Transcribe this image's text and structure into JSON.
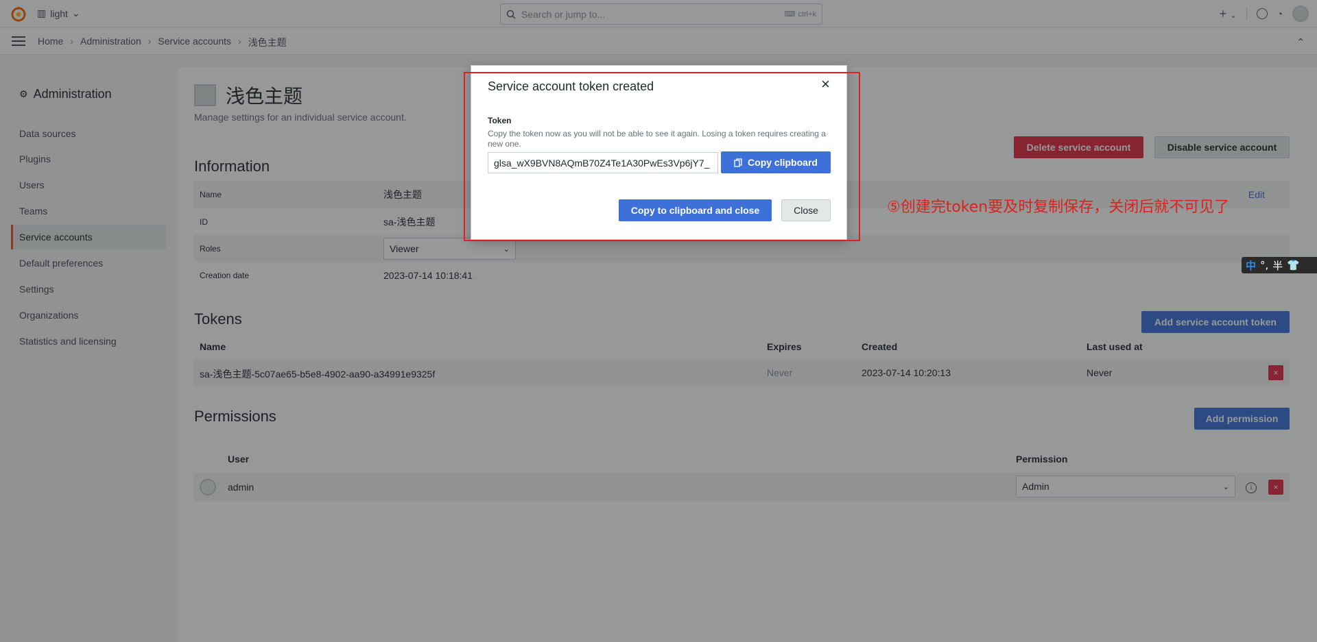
{
  "topbar": {
    "org_name": "light",
    "search_placeholder": "Search or jump to...",
    "search_shortcut": "ctrl+k",
    "plus_label": "+"
  },
  "breadcrumb": [
    "Home",
    "Administration",
    "Service accounts",
    "浅色主题"
  ],
  "sidebar": {
    "title": "Administration",
    "items": [
      {
        "label": "Data sources"
      },
      {
        "label": "Plugins"
      },
      {
        "label": "Users"
      },
      {
        "label": "Teams"
      },
      {
        "label": "Service accounts"
      },
      {
        "label": "Default preferences"
      },
      {
        "label": "Settings"
      },
      {
        "label": "Organizations"
      },
      {
        "label": "Statistics and licensing"
      }
    ]
  },
  "account": {
    "title": "浅色主题",
    "subtitle": "Manage settings for an individual service account.",
    "delete_label": "Delete service account",
    "disable_label": "Disable service account"
  },
  "information": {
    "heading": "Information",
    "rows": [
      {
        "label": "Name",
        "value": "浅色主题",
        "action": "Edit"
      },
      {
        "label": "ID",
        "value": "sa-浅色主题"
      },
      {
        "label": "Roles",
        "value": "Viewer"
      },
      {
        "label": "Creation date",
        "value": "2023-07-14 10:18:41"
      }
    ]
  },
  "tokens": {
    "heading": "Tokens",
    "add_label": "Add service account token",
    "columns": [
      "Name",
      "Expires",
      "Created",
      "Last used at"
    ],
    "rows": [
      {
        "name": "sa-浅色主题-5c07ae65-b5e8-4902-aa90-a34991e9325f",
        "expires": "Never",
        "created": "2023-07-14 10:20:13",
        "last_used": "Never",
        "delete": "×"
      }
    ]
  },
  "permissions": {
    "heading": "Permissions",
    "add_label": "Add permission",
    "columns": [
      "User",
      "Permission"
    ],
    "rows": [
      {
        "user": "admin",
        "permission": "Admin",
        "delete": "×"
      }
    ]
  },
  "modal": {
    "title": "Service account token created",
    "close_icon": "×",
    "token_label": "Token",
    "token_desc": "Copy the token now as you will not be able to see it again. Losing a token requires creating a new one.",
    "token_value": "glsa_wX9BVN8AQmB70Z4Te1A30PwEs3Vp6jY7_",
    "copy_label": "Copy clipboard",
    "copy_close_label": "Copy to clipboard and close",
    "close_label": "Close"
  },
  "annotation": {
    "text": "⑤创建完token要及时复制保存，关闭后就不可见了",
    "color": "#e0201c"
  },
  "ime": {
    "mode": "中",
    "punct": "°,",
    "width": "半"
  },
  "colors": {
    "accent": "#3d71d9",
    "danger": "#e02f44",
    "active_marker": "#f05a28"
  }
}
